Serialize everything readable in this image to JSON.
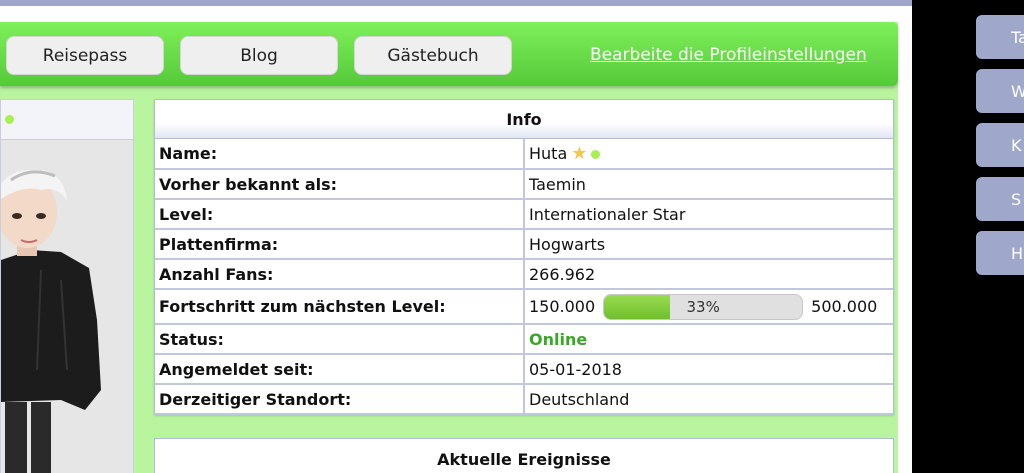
{
  "nav": {
    "buttons": [
      "Reisepass",
      "Blog",
      "Gästebuch"
    ],
    "edit_link": "Bearbeite die Profileinstellungen"
  },
  "info": {
    "title": "Info",
    "rows": [
      {
        "key": "Name:",
        "value": "Huta"
      },
      {
        "key": "Vorher bekannt als:",
        "value": "Taemin"
      },
      {
        "key": "Level:",
        "value": "Internationaler Star"
      },
      {
        "key": "Plattenfirma:",
        "value": "Hogwarts"
      },
      {
        "key": "Anzahl Fans:",
        "value": "266.962"
      },
      {
        "key": "Fortschritt zum nächsten Level:",
        "from": "150.000",
        "percent_label": "33%",
        "to": "500.000",
        "progress_fraction": 0.33
      },
      {
        "key": "Status:",
        "value": "Online"
      },
      {
        "key": "Angemeldet seit:",
        "value": "05-01-2018"
      },
      {
        "key": "Derzeitiger Standort:",
        "value": "Deutschland"
      }
    ]
  },
  "events": {
    "title": "Aktuelle Ereignisse"
  },
  "side_tabs": [
    "Ta",
    "W",
    "K",
    "S",
    "H"
  ],
  "colors": {
    "nav_green": "#6ee04c",
    "page_green": "#b8f59e",
    "online_green": "#3ca52a",
    "side_tab": "#9fa7cb"
  }
}
